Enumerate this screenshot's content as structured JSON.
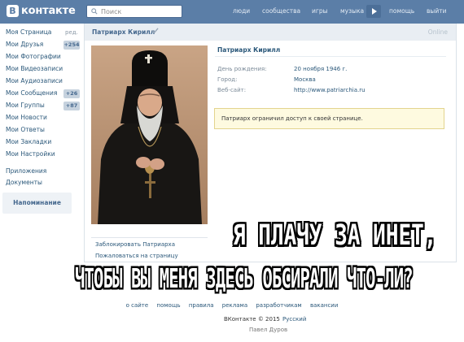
{
  "header": {
    "logo_mark": "B",
    "logo_text": "контакте",
    "search_placeholder": "Поиск",
    "nav": [
      "люди",
      "сообщества",
      "игры",
      "музыка",
      "помощь",
      "выйти"
    ]
  },
  "sidebar": {
    "items": [
      {
        "label": "Моя Страница",
        "aux": "ред."
      },
      {
        "label": "Мои Друзья",
        "badge": "+254"
      },
      {
        "label": "Мои Фотографии"
      },
      {
        "label": "Мои Видеозаписи"
      },
      {
        "label": "Мои Аудиозаписи"
      },
      {
        "label": "Мои Сообщения",
        "badge": "+26"
      },
      {
        "label": "Мои Группы",
        "badge": "+87"
      },
      {
        "label": "Мои Новости"
      },
      {
        "label": "Мои Ответы"
      },
      {
        "label": "Мои Закладки"
      },
      {
        "label": "Мои Настройки"
      }
    ],
    "extra": [
      "Приложения",
      "Документы"
    ],
    "reminder": "Напоминание"
  },
  "profile": {
    "header_name": "Патриарх Кирилл",
    "online_status": "Online",
    "name": "Патриарх Кирилл",
    "info": [
      {
        "label": "День рождения:",
        "value": "20 ноября 1946 г."
      },
      {
        "label": "Город:",
        "value": "Москва"
      },
      {
        "label": "Веб-сайт:",
        "value": "http://www.patriarchia.ru"
      }
    ],
    "notice": "Патриарх ограничил доступ к своей странице.",
    "actions": [
      "Заблокировать Патриарха",
      "Пожаловаться на страницу"
    ]
  },
  "caption": {
    "line1": "Я ПЛАЧУ ЗА ИНЕТ,",
    "line2": "ЧТОБЫ ВЫ МЕНЯ ЗДЕСЬ ОБСИРАЛИ ЧТО-ЛИ?"
  },
  "footer": {
    "links": [
      "о сайте",
      "помощь",
      "правила",
      "реклама",
      "разработчикам",
      "вакансии"
    ],
    "copyright": "ВКонтакте © 2015",
    "language": "Русский",
    "founder": "Павел Дуров"
  },
  "colors": {
    "header_bg": "#5b7ea7",
    "link": "#2b587a",
    "notice_bg": "#fefae0"
  }
}
